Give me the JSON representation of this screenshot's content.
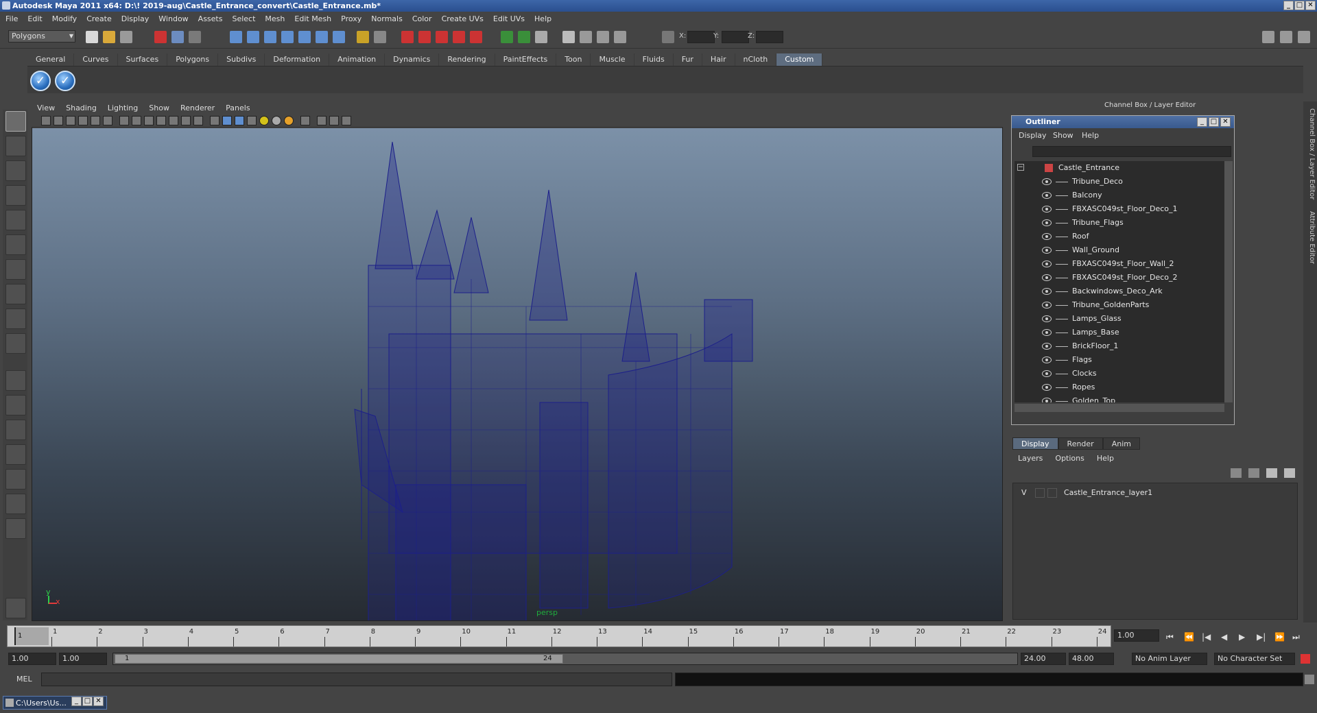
{
  "window": {
    "title": "Autodesk Maya 2011 x64: D:\\! 2019-aug\\Castle_Entrance_convert\\Castle_Entrance.mb*",
    "btn_min": "_",
    "btn_max": "□",
    "btn_close": "✕"
  },
  "menubar": [
    "File",
    "Edit",
    "Modify",
    "Create",
    "Display",
    "Window",
    "Assets",
    "Select",
    "Mesh",
    "Edit Mesh",
    "Proxy",
    "Normals",
    "Color",
    "Create UVs",
    "Edit UVs",
    "Help"
  ],
  "statusline": {
    "mode": "Polygons",
    "x_label": "X:",
    "y_label": "Y:",
    "z_label": "Z:"
  },
  "shelf": {
    "tabs": [
      "General",
      "Curves",
      "Surfaces",
      "Polygons",
      "Subdivs",
      "Deformation",
      "Animation",
      "Dynamics",
      "Rendering",
      "PaintEffects",
      "Toon",
      "Muscle",
      "Fluids",
      "Fur",
      "Hair",
      "nCloth",
      "Custom"
    ],
    "active_tab": "Custom",
    "check_glyph": "✓"
  },
  "viewport": {
    "menu": [
      "View",
      "Shading",
      "Lighting",
      "Show",
      "Renderer",
      "Panels"
    ],
    "camera_label": "persp",
    "axis_y": "y",
    "axis_x": "x"
  },
  "channel_box_title": "Channel Box / Layer Editor",
  "side_tabs": [
    "Channel Box / Layer Editor",
    "Attribute Editor"
  ],
  "outliner": {
    "title": "Outliner",
    "menu": [
      "Display",
      "Show",
      "Help"
    ],
    "root": "Castle_Entrance",
    "items": [
      "Tribune_Deco",
      "Balcony",
      "FBXASC049st_Floor_Deco_1",
      "Tribune_Flags",
      "Roof",
      "Wall_Ground",
      "FBXASC049st_Floor_Wall_2",
      "FBXASC049st_Floor_Deco_2",
      "Backwindows_Deco_Ark",
      "Tribune_GoldenParts",
      "Lamps_Glass",
      "Lamps_Base",
      "BrickFloor_1",
      "Flags",
      "Clocks",
      "Ropes",
      "Golden_Top"
    ]
  },
  "layer_editor": {
    "tabs": [
      "Display",
      "Render",
      "Anim"
    ],
    "active_tab": "Display",
    "menu": [
      "Layers",
      "Options",
      "Help"
    ],
    "layer_visible": "V",
    "layer_name": "Castle_Entrance_layer1"
  },
  "timeline": {
    "ticks": [
      "1",
      "2",
      "3",
      "4",
      "5",
      "6",
      "7",
      "8",
      "9",
      "10",
      "11",
      "12",
      "13",
      "14",
      "15",
      "16",
      "17",
      "18",
      "19",
      "20",
      "21",
      "22",
      "23",
      "24"
    ],
    "current_marker": "1",
    "current_frame": "1.00"
  },
  "playback": [
    "⏮",
    "⏪",
    "|◀",
    "◀",
    "▶",
    "▶|",
    "⏩",
    "⏭"
  ],
  "range": {
    "start": "1.00",
    "playback_start": "1.00",
    "slider_start": "1",
    "slider_end": "24",
    "playback_end": "24.00",
    "end": "48.00",
    "anim_layer": "No Anim Layer",
    "character_set": "No Character Set"
  },
  "command_line": {
    "label": "MEL"
  },
  "taskbar": {
    "item": "C:\\Users\\Us..."
  },
  "colors": {
    "wireframe": "#1c1f8a",
    "title_blue": "#2a4f8f",
    "active_tab": "#5e6d80"
  }
}
